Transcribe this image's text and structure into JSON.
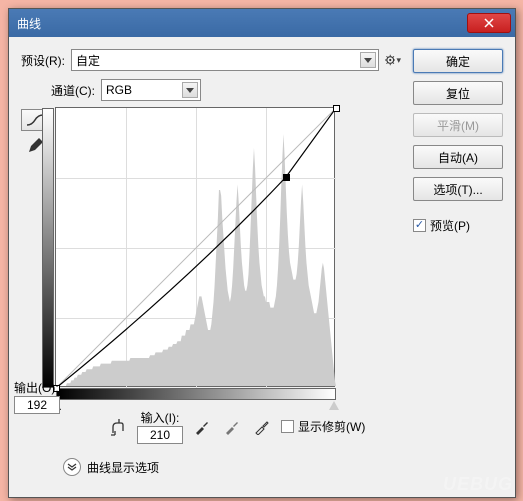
{
  "window": {
    "title": "曲线"
  },
  "preset": {
    "label": "预设(R):",
    "value": "自定"
  },
  "channel": {
    "label": "通道(C):",
    "value": "RGB"
  },
  "output": {
    "label": "输出(O):",
    "value": "192"
  },
  "input": {
    "label": "输入(I):",
    "value": "210"
  },
  "show_clipping": {
    "label": "显示修剪(W)",
    "checked": false
  },
  "curve_options": {
    "label": "曲线显示选项"
  },
  "buttons": {
    "ok": "确定",
    "reset": "复位",
    "smooth": "平滑(M)",
    "auto": "自动(A)",
    "options": "选项(T)..."
  },
  "preview": {
    "label": "预览(P)",
    "checked": true
  },
  "chart_data": {
    "type": "curve",
    "xlabel": "输入",
    "ylabel": "输出",
    "x_range": [
      0,
      255
    ],
    "y_range": [
      0,
      255
    ],
    "grid_divisions": 4,
    "baseline": [
      [
        0,
        0
      ],
      [
        255,
        255
      ]
    ],
    "curve_points": [
      [
        0,
        0
      ],
      [
        210,
        192
      ],
      [
        255,
        255
      ]
    ],
    "histogram_approx": [
      0,
      0,
      0,
      0,
      0,
      0,
      0,
      0,
      0,
      0,
      1,
      1,
      1,
      1,
      2,
      2,
      2,
      3,
      3,
      3,
      4,
      4,
      4,
      4,
      5,
      5,
      5,
      5,
      6,
      6,
      6,
      6,
      6,
      6,
      7,
      7,
      7,
      7,
      7,
      7,
      7,
      8,
      8,
      8,
      8,
      8,
      8,
      8,
      8,
      8,
      8,
      9,
      9,
      9,
      9,
      9,
      9,
      9,
      9,
      9,
      9,
      9,
      9,
      9,
      9,
      9,
      9,
      9,
      10,
      10,
      10,
      10,
      10,
      10,
      10,
      10,
      10,
      10,
      10,
      10,
      10,
      10,
      10,
      10,
      10,
      10,
      11,
      11,
      11,
      11,
      11,
      12,
      12,
      12,
      12,
      12,
      12,
      12,
      13,
      13,
      13,
      13,
      13,
      14,
      14,
      14,
      14,
      15,
      15,
      15,
      15,
      16,
      16,
      16,
      16,
      18,
      18,
      18,
      18,
      20,
      20,
      20,
      20,
      22,
      22,
      22,
      22,
      24,
      26,
      28,
      30,
      32,
      32,
      32,
      30,
      28,
      26,
      24,
      22,
      20,
      20,
      20,
      22,
      26,
      30,
      36,
      44,
      52,
      60,
      70,
      70,
      68,
      60,
      54,
      48,
      42,
      38,
      34,
      32,
      30,
      32,
      36,
      42,
      50,
      58,
      66,
      72,
      66,
      58,
      50,
      44,
      40,
      36,
      34,
      34,
      36,
      40,
      48,
      58,
      68,
      78,
      85,
      78,
      68,
      58,
      50,
      44,
      40,
      36,
      34,
      32,
      32,
      30,
      30,
      30,
      30,
      28,
      28,
      28,
      28,
      30,
      32,
      36,
      42,
      50,
      60,
      72,
      82,
      90,
      82,
      72,
      62,
      54,
      48,
      44,
      42,
      40,
      38,
      38,
      38,
      40,
      44,
      50,
      58,
      66,
      72,
      66,
      58,
      50,
      44,
      40,
      36,
      34,
      32,
      30,
      28,
      26,
      26,
      26,
      28,
      30,
      34,
      38,
      42,
      44,
      42,
      38,
      34,
      30,
      26,
      22,
      18,
      14,
      10,
      6,
      2,
      0
    ]
  }
}
